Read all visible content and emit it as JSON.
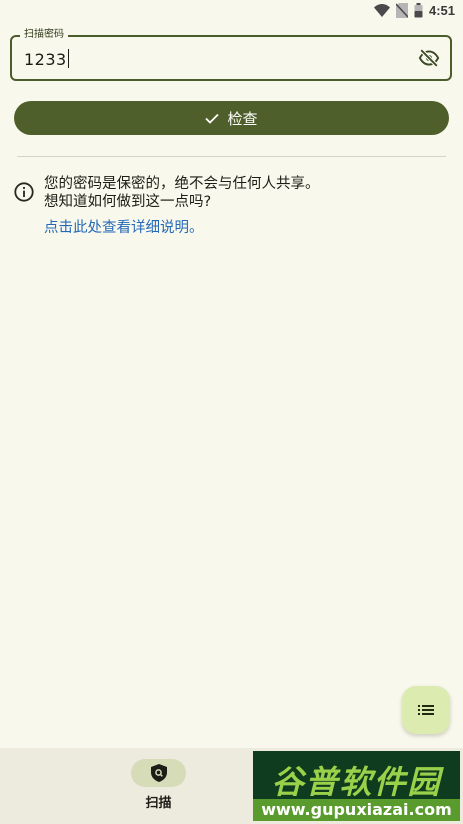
{
  "status_bar": {
    "time": "4:51"
  },
  "password_field": {
    "label": "扫描密码",
    "value": "1233"
  },
  "check_button": {
    "label": "检查"
  },
  "info": {
    "line1": "您的密码是保密的，绝不会与任何人共享。",
    "line2": "想知道如何做到这一点吗?",
    "link": "点击此处查看详细说明。"
  },
  "bottom_nav": {
    "items": [
      {
        "label": "扫描",
        "icon": "shield-search-icon",
        "selected": true
      }
    ]
  },
  "watermark": {
    "title": "谷普软件园",
    "url": "www.gupuxiazai.com"
  },
  "colors": {
    "background": "#f9f8ec",
    "primary": "#4f5f2b",
    "link": "#2469b8",
    "fab": "#dcebb0"
  }
}
